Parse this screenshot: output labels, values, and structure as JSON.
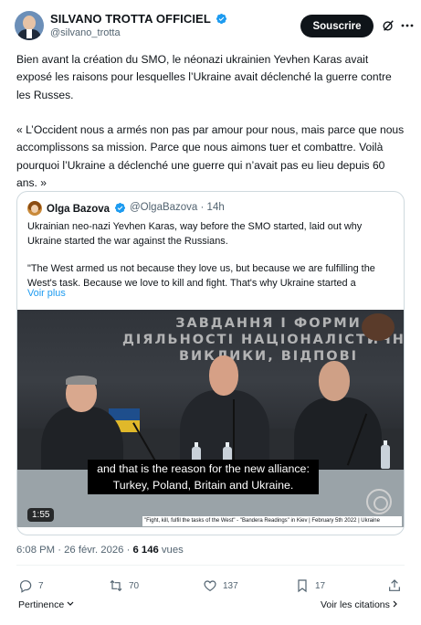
{
  "author": {
    "name": "SILVANO TROTTA OFFICIEL",
    "handle": "@silvano_trotta",
    "subscribe_label": "Souscrire"
  },
  "tweet": {
    "paragraph1": "Bien avant la création du SMO, le néonazi ukrainien Yevhen Karas avait exposé les raisons pour lesquelles l’Ukraine avait déclenché la guerre contre les Russes.",
    "paragraph2": "« L’Occident nous a armés non pas par amour pour nous, mais parce que nous accomplissons sa mission. Parce que nous aimons tuer et combattre. Voilà pourquoi l’Ukraine a déclenché une guerre qui n’avait pas eu lieu depuis 60 ans. »"
  },
  "quote": {
    "name": "Olga Bazova",
    "handle": "@OlgaBazova · 14h",
    "text1": "Ukrainian neo-nazi Yevhen Karas, way before the SMO started, laid out why Ukraine started the war against the Russians.",
    "text2": "\"The West armed us not because they love us, but because we are fulfilling the West's task. Because we love to kill and fight. That's why Ukraine started a",
    "read_more": "Voir plus",
    "video": {
      "banner_line1": "ЗАВДАННЯ І ФОРМИ",
      "banner_line2": "ДІЯЛЬНОСТІ НАЦІОНАЛІСТИЧНОГО РУХ",
      "banner_line3": "ВИКЛИКИ, ВІДПОВІ",
      "subtitle_line1": "and that is the reason for the new alliance:",
      "subtitle_line2": "Turkey, Poland, Britain and Ukraine.",
      "duration": "1:55",
      "caption": "\"Fight, kill, fulfil the tasks of the West\" - \"Bandera Readings\" in Kiev | February 5th 2022 | Ukraine"
    }
  },
  "meta": {
    "timestamp": "6:08 PM · 26 févr. 2026 · ",
    "views_count": "6 146",
    "views_label": " vues"
  },
  "actions": {
    "replies": "7",
    "reposts": "70",
    "likes": "137",
    "bookmarks": "17"
  },
  "footer": {
    "relevance": "Pertinence",
    "view_quotes": "Voir les citations"
  },
  "colors": {
    "link": "#1d9bf0",
    "verified": "#1d9bf0",
    "muted": "#536471",
    "text": "#0f1419"
  }
}
